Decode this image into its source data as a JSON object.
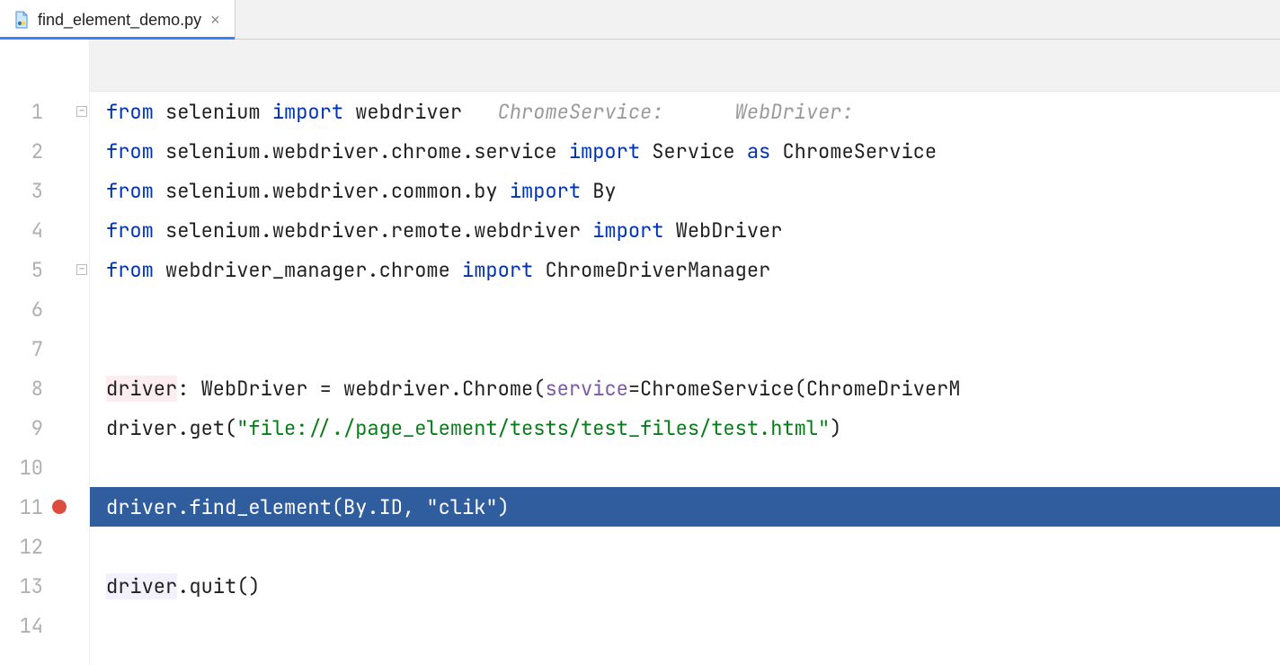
{
  "tab": {
    "filename": "find_element_demo.py",
    "close_glyph": "×"
  },
  "gutter": {
    "lines": [
      "1",
      "2",
      "3",
      "4",
      "5",
      "6",
      "7",
      "8",
      "9",
      "10",
      "11",
      "12",
      "13",
      "14"
    ],
    "breakpoint_line": 11,
    "fold_start": 1,
    "fold_end": 5
  },
  "tokens": {
    "from": "from",
    "import": "import",
    "as": "as",
    "selenium": "selenium",
    "webdriver": "webdriver",
    "chrome_service_path": "selenium.webdriver.chrome.service",
    "common_by_path": "selenium.webdriver.common.by",
    "remote_webdriver_path": "selenium.webdriver.remote.webdriver",
    "wdm_chrome_path": "webdriver_manager.chrome",
    "Service": "Service",
    "ChromeService": "ChromeService",
    "By": "By",
    "WebDriver": "WebDriver",
    "ChromeDriverManager": "ChromeDriverManager",
    "hint_chrome_service": "ChromeService:",
    "hint_webdriver": "WebDriver:",
    "driver": "driver",
    "colon_sp": ": ",
    "eq": " = ",
    "webdriver_Chrome_open": "webdriver.Chrome(",
    "service_kw": "service",
    "eq2": "=",
    "ChromeService_open": "ChromeService(",
    "ChromeDriverM_trunc": "ChromeDriverM",
    "dot_get_open": ".get(",
    "url_str": "\"file://./page_element/tests/test_files/test.html\"",
    "close_paren": ")",
    "find_element_call": "driver.find_element(By.ID, \"clik\")",
    "dot_quit": ".quit()"
  }
}
